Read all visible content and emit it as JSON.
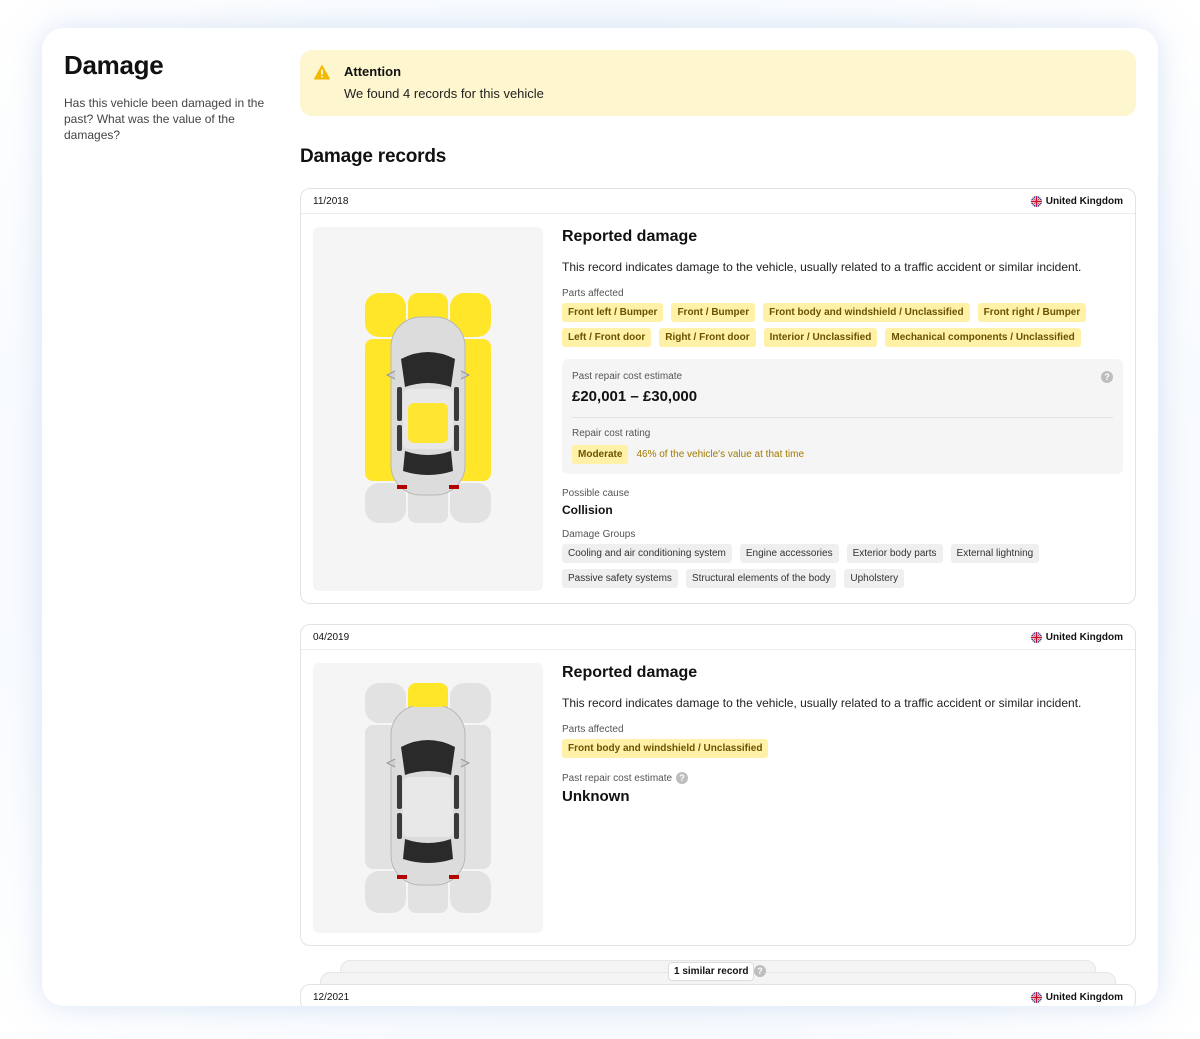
{
  "sidebar": {
    "title": "Damage",
    "description": "Has this vehicle been damaged in the past? What was the value of the damages?"
  },
  "alert": {
    "title": "Attention",
    "message": "We found 4 records for this vehicle",
    "icon": "warning-icon",
    "color": "#f5b800"
  },
  "section_title": "Damage records",
  "records": [
    {
      "date": "11/2018",
      "country": "United Kingdom",
      "title": "Reported damage",
      "description": "This record indicates damage to the vehicle, usually related to a traffic accident or similar incident.",
      "parts_label": "Parts affected",
      "parts": [
        "Front left / Bumper",
        "Front / Bumper",
        "Front body and windshield / Unclassified",
        "Front right / Bumper",
        "Left / Front door",
        "Right / Front door",
        "Interior / Unclassified",
        "Mechanical components / Unclassified"
      ],
      "cost_label": "Past repair cost estimate",
      "cost_value": "£20,001 – £30,000",
      "rating_label": "Repair cost rating",
      "rating_value": "Moderate",
      "rating_note": "46% of the vehicle's value at that time",
      "cause_label": "Possible cause",
      "cause_value": "Collision",
      "groups_label": "Damage Groups",
      "groups": [
        "Cooling and air conditioning system",
        "Engine accessories",
        "Exterior body parts",
        "External lightning",
        "Passive safety systems",
        "Structural elements of the body",
        "Upholstery"
      ]
    },
    {
      "date": "04/2019",
      "country": "United Kingdom",
      "title": "Reported damage",
      "description": "This record indicates damage to the vehicle, usually related to a traffic accident or similar incident.",
      "parts_label": "Parts affected",
      "parts": [
        "Front body and windshield / Unclassified"
      ],
      "cost_label": "Past repair cost estimate",
      "cost_value": "Unknown"
    },
    {
      "date": "12/2021",
      "country": "United Kingdom"
    }
  ],
  "similar_label": "1 similar record",
  "colors": {
    "damage": "#ffe629",
    "zone": "#e2e2e2",
    "chip": "#fff2a8"
  }
}
